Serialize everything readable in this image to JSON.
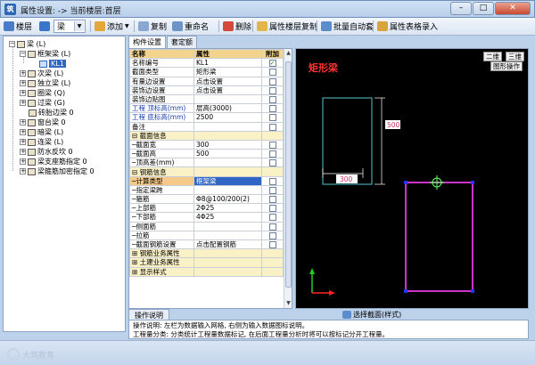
{
  "window": {
    "title": "属性设置: -> 当前楼层:首层",
    "app_icon_glyph": "筑",
    "buttons": {
      "minimize": "–",
      "maximize": "□",
      "close": "✕"
    }
  },
  "toolbar": {
    "layer_label": "楼层",
    "component_combo": "梁",
    "add_label": "添加",
    "copy_label": "复制",
    "rename_label": "重命名",
    "delete_label": "删除",
    "floor_copy_label": "属性楼层复制",
    "batch_label": "批量自动套",
    "table_input_label": "属性表格录入",
    "dropdown_arrow": "▼"
  },
  "tree": {
    "nodes": [
      {
        "label": "梁 (L)",
        "pm": "−"
      },
      {
        "label": "框架梁 (L)",
        "pm": "−"
      },
      {
        "label": "KL1"
      },
      {
        "label": "次梁 (L)",
        "pm": "+"
      },
      {
        "label": "独立梁 (L)",
        "pm": "+"
      },
      {
        "label": "圈梁 (Q)",
        "pm": "+"
      },
      {
        "label": "过梁 (G)",
        "pm": "+"
      },
      {
        "label": "砖胎边梁 0"
      },
      {
        "label": "窗台梁 0",
        "pm": "+"
      },
      {
        "label": "暗梁 (L)",
        "pm": "+"
      },
      {
        "label": "连梁 (L)",
        "pm": "+"
      },
      {
        "label": "防水反坎 0",
        "pm": "+"
      },
      {
        "label": "梁支座筋指定 0",
        "pm": "+"
      },
      {
        "label": "梁箍筋加密指定 0",
        "pm": "+"
      }
    ]
  },
  "tabs": {
    "props": "构件设置",
    "rebar": "套定额"
  },
  "grid": {
    "headers": [
      "名称",
      "属性",
      "附加"
    ],
    "rows": [
      {
        "name": "名称编号",
        "value": "KL1",
        "check": "✓",
        "cls": ""
      },
      {
        "name": "截面类型",
        "value": "矩形梁",
        "check": "",
        "cls": ""
      },
      {
        "name": "有量边设置",
        "value": "点击设置",
        "check": "",
        "cls": ""
      },
      {
        "name": "装饰边设置",
        "value": "点击设置",
        "check": "",
        "cls": ""
      },
      {
        "name": "装饰边贴图",
        "value": "",
        "check": "",
        "cls": ""
      },
      {
        "name": "工程 顶标高(mm)",
        "value": "层高(3000)",
        "check": "",
        "cls": "blue"
      },
      {
        "name": "工程 底标高(mm)",
        "value": "2500",
        "check": "",
        "cls": "blue"
      },
      {
        "name": "备注",
        "value": "",
        "check": "",
        "cls": ""
      },
      {
        "name": "⊟ 截面信息",
        "value": "",
        "check": "",
        "cls": "sect"
      },
      {
        "name": "  ─截面宽",
        "value": "300",
        "check": "",
        "cls": ""
      },
      {
        "name": "  ─截面高",
        "value": "500",
        "check": "",
        "cls": ""
      },
      {
        "name": "  ─顶高差(mm)",
        "value": "",
        "check": "",
        "cls": ""
      },
      {
        "name": "⊟ 钢筋信息",
        "value": "",
        "check": "",
        "cls": "sect"
      },
      {
        "name": "  ─计算类型",
        "value": "框架梁",
        "check": "",
        "cls": "hl"
      },
      {
        "name": "  ─指定梁跨",
        "value": "",
        "check": "",
        "cls": ""
      },
      {
        "name": "  ─箍筋",
        "value": "Φ8@100/200(2)",
        "check": "",
        "cls": ""
      },
      {
        "name": "  ─上部筋",
        "value": "2Φ25",
        "check": "",
        "cls": ""
      },
      {
        "name": "  ─下部筋",
        "value": "4Φ25",
        "check": "",
        "cls": ""
      },
      {
        "name": "  ─侧面筋",
        "value": "",
        "check": "",
        "cls": ""
      },
      {
        "name": "  ─拉筋",
        "value": "",
        "check": "",
        "cls": ""
      },
      {
        "name": "  ─截面钢筋设置",
        "value": "点击配置钢筋",
        "check": "",
        "cls": ""
      },
      {
        "name": "⊞ 钢筋业务属性",
        "value": "",
        "check": "",
        "cls": "sect"
      },
      {
        "name": "⊞ 土建业务属性",
        "value": "",
        "check": "",
        "cls": "sect"
      },
      {
        "name": "⊞ 显示样式",
        "value": "",
        "check": "",
        "cls": "sect"
      }
    ]
  },
  "canvas": {
    "title": "矩形梁",
    "view_2d": "二维",
    "view_3d": "三维",
    "graphic_op": "图形操作",
    "dim_height": "500",
    "dim_width": "300",
    "colors": {
      "outline": "#55c8d0",
      "section": "#cc33cc",
      "dim": "#ffffff",
      "title": "#ff3333",
      "axis_y": "#22cc22",
      "axis_x": "#ff2222"
    }
  },
  "bottom": {
    "select_section": "选择截面(样式)",
    "desc_tab": "操作说明",
    "desc_line1": "操作说明: 左栏为数据输入网格, 右侧为输入数据图标说明。",
    "desc_line2": "工程量分类: 分类统计工程量数据标记, 在后面工程量分析时将可以按标记分开工程量。"
  },
  "watermark": "大筑教育"
}
